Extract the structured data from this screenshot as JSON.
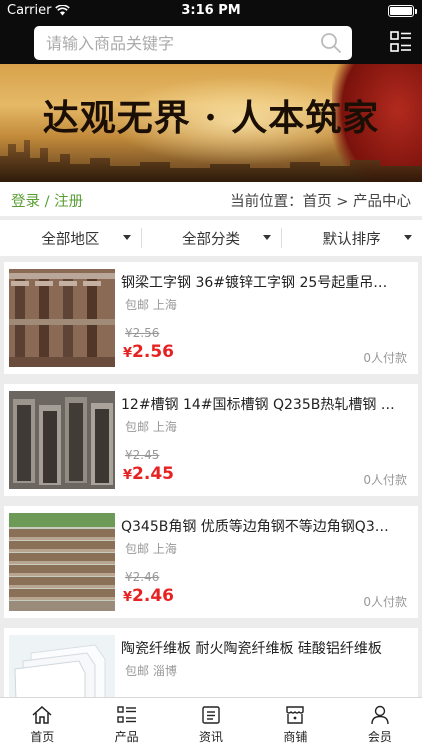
{
  "status_bar": {
    "carrier": "Carrier",
    "time": "3:16 PM"
  },
  "search": {
    "placeholder": "请输入商品关键字"
  },
  "banner": {
    "slogan": "达观无界 · 人本筑家"
  },
  "auth": {
    "login": "登录",
    "separator": " / ",
    "register": "注册"
  },
  "breadcrumb": {
    "prefix": "当前位置：",
    "home": "首页",
    "arrow": " > ",
    "current": "产品中心"
  },
  "filters": [
    "全部地区",
    "全部分类",
    "默认排序"
  ],
  "products": [
    {
      "title": "钢梁工字钢 36#镀锌工字钢 25号起重吊…",
      "shipping": "包邮",
      "location": "上海",
      "old_price": "¥2.56",
      "currency": "¥",
      "price": "2.56",
      "paid": "0人付款",
      "image": "i-beam-steel"
    },
    {
      "title": "12#槽钢 14#国标槽钢 Q235B热轧槽钢 …",
      "shipping": "包邮",
      "location": "上海",
      "old_price": "¥2.45",
      "currency": "¥",
      "price": "2.45",
      "paid": "0人付款",
      "image": "channel-steel"
    },
    {
      "title": "Q345B角钢 优质等边角钢不等边角钢Q3…",
      "shipping": "包邮",
      "location": "上海",
      "old_price": "¥2.46",
      "currency": "¥",
      "price": "2.46",
      "paid": "0人付款",
      "image": "angle-steel"
    },
    {
      "title": "陶瓷纤维板 耐火陶瓷纤维板 硅酸铝纤维板",
      "shipping": "包邮",
      "location": "淄博",
      "old_price": "",
      "currency": "",
      "price": "",
      "paid": "",
      "image": "ceramic-fiber-board"
    }
  ],
  "tabs": [
    {
      "label": "首页",
      "icon": "home-icon"
    },
    {
      "label": "产品",
      "icon": "grid-list-icon"
    },
    {
      "label": "资讯",
      "icon": "news-icon"
    },
    {
      "label": "商铺",
      "icon": "store-icon"
    },
    {
      "label": "会员",
      "icon": "user-icon"
    }
  ],
  "colors": {
    "accent_green": "#5a9f34",
    "price_red": "#e62222",
    "top_bar": "#0c0c0c"
  }
}
